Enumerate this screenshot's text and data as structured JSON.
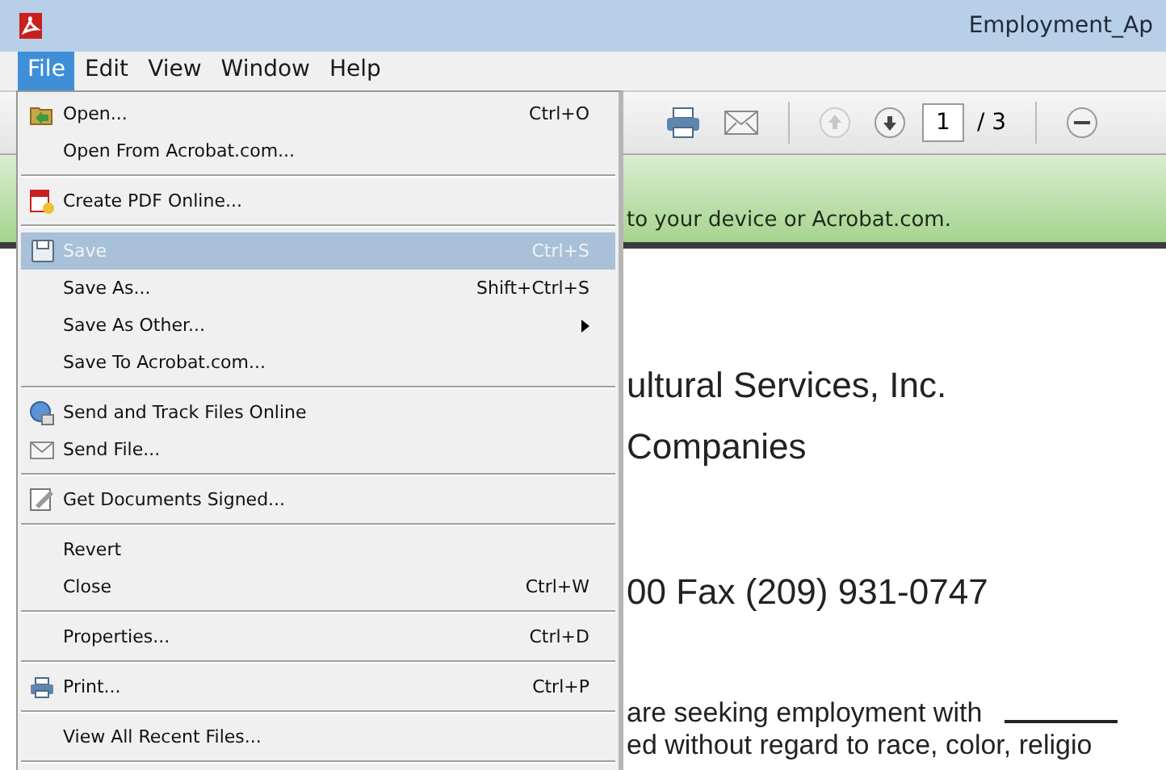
{
  "window": {
    "title": "Employment_Ap"
  },
  "menu_bar": [
    {
      "label": "File",
      "selected": true
    },
    {
      "label": "Edit",
      "selected": false
    },
    {
      "label": "View",
      "selected": false
    },
    {
      "label": "Window",
      "selected": false
    },
    {
      "label": "Help",
      "selected": false
    }
  ],
  "file_menu": [
    {
      "kind": "item",
      "label": "Open...",
      "shortcut": "Ctrl+O",
      "disabled": false,
      "selected": false
    },
    {
      "kind": "item",
      "label": "Open From Acrobat.com...",
      "disabled": false,
      "selected": false
    },
    {
      "kind": "separator"
    },
    {
      "kind": "item",
      "label": "Create PDF Online...",
      "disabled": false,
      "selected": false
    },
    {
      "kind": "separator"
    },
    {
      "kind": "item",
      "label": "Save",
      "shortcut": "Ctrl+S",
      "disabled": true,
      "selected": true
    },
    {
      "kind": "item",
      "label": "Save As...",
      "shortcut": "Shift+Ctrl+S",
      "disabled": false,
      "selected": false
    },
    {
      "kind": "item",
      "label": "Save As Other...",
      "submenu": true,
      "disabled": false,
      "selected": false
    },
    {
      "kind": "item",
      "label": "Save To Acrobat.com...",
      "disabled": false,
      "selected": false
    },
    {
      "kind": "separator"
    },
    {
      "kind": "item",
      "label": "Send and Track Files Online",
      "disabled": false,
      "selected": false
    },
    {
      "kind": "item",
      "label": "Send File...",
      "disabled": false,
      "selected": false
    },
    {
      "kind": "separator"
    },
    {
      "kind": "item",
      "label": "Get Documents Signed...",
      "disabled": false,
      "selected": false
    },
    {
      "kind": "separator"
    },
    {
      "kind": "item",
      "label": "Revert",
      "disabled": false,
      "selected": false
    },
    {
      "kind": "item",
      "label": "Close",
      "shortcut": "Ctrl+W",
      "disabled": false,
      "selected": false
    },
    {
      "kind": "separator"
    },
    {
      "kind": "item",
      "label": "Properties...",
      "shortcut": "Ctrl+D",
      "disabled": false,
      "selected": false
    },
    {
      "kind": "separator"
    },
    {
      "kind": "item",
      "label": "Print...",
      "shortcut": "Ctrl+P",
      "disabled": false,
      "selected": false
    },
    {
      "kind": "separator"
    },
    {
      "kind": "item",
      "label": "View All Recent Files...",
      "disabled": false,
      "selected": false
    },
    {
      "kind": "separator"
    }
  ],
  "toolbar": {
    "page_number": "1",
    "page_count": "/ 3"
  },
  "banner": {
    "text": "to your device or Acrobat.com."
  },
  "document": {
    "lines": [
      {
        "kind": "heading",
        "text": "ultural Services, Inc."
      },
      {
        "kind": "heading",
        "text": "Companies"
      },
      {
        "kind": "spacer"
      },
      {
        "kind": "heading",
        "text": "00 Fax (209) 931-0747"
      },
      {
        "kind": "spacer"
      },
      {
        "kind": "body",
        "text": "are seeking employment with",
        "blank": true
      },
      {
        "kind": "body",
        "text": "ed without regard to race, color, religio"
      }
    ]
  }
}
